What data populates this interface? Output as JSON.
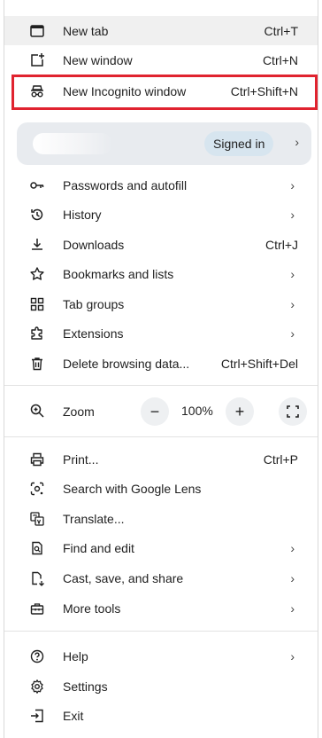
{
  "menu": {
    "top_items": [
      {
        "label": "New tab",
        "shortcut": "Ctrl+T",
        "icon": "new-tab-icon"
      },
      {
        "label": "New window",
        "shortcut": "Ctrl+N",
        "icon": "new-window-icon"
      },
      {
        "label": "New Incognito window",
        "shortcut": "Ctrl+Shift+N",
        "icon": "incognito-icon"
      }
    ],
    "profile": {
      "status": "Signed in"
    },
    "items": [
      {
        "label": "Passwords and autofill",
        "icon": "key-icon"
      },
      {
        "label": "History",
        "icon": "history-icon"
      },
      {
        "label": "Downloads",
        "shortcut": "Ctrl+J",
        "icon": "download-icon"
      },
      {
        "label": "Bookmarks and lists",
        "icon": "star-icon"
      },
      {
        "label": "Tab groups",
        "icon": "tab-groups-icon"
      },
      {
        "label": "Extensions",
        "icon": "puzzle-icon"
      },
      {
        "label": "Delete browsing data...",
        "shortcut": "Ctrl+Shift+Del",
        "icon": "trash-icon"
      }
    ],
    "zoom": {
      "label": "Zoom",
      "minus": "−",
      "value": "100%",
      "plus": "+"
    },
    "tools": [
      {
        "label": "Print...",
        "shortcut": "Ctrl+P",
        "icon": "print-icon"
      },
      {
        "label": "Search with Google Lens",
        "icon": "lens-icon"
      },
      {
        "label": "Translate...",
        "icon": "translate-icon"
      },
      {
        "label": "Find and edit",
        "icon": "find-icon"
      },
      {
        "label": "Cast, save, and share",
        "icon": "cast-icon"
      },
      {
        "label": "More tools",
        "icon": "toolbox-icon"
      }
    ],
    "bottom": [
      {
        "label": "Help",
        "icon": "help-icon"
      },
      {
        "label": "Settings",
        "icon": "gear-icon"
      },
      {
        "label": "Exit",
        "icon": "exit-icon"
      }
    ],
    "chevron": "›"
  }
}
